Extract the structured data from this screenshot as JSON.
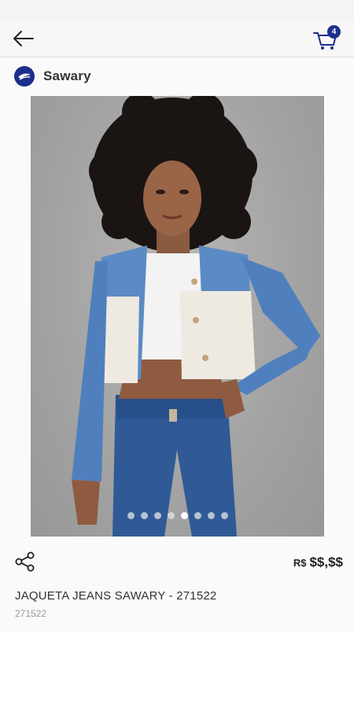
{
  "header": {
    "back_icon": "arrow-left-icon",
    "cart_icon": "shopping-cart-icon",
    "cart_count": "4"
  },
  "brand": {
    "name": "Sawary",
    "logo_icon": "sawary-logo-icon",
    "color": "#1c2f8a"
  },
  "gallery": {
    "image_alt": "Model wearing cropped denim jacket with sherpa panels and blue jeans",
    "slides_total": 8,
    "active_index": 4
  },
  "product": {
    "currency": "R$",
    "price": "$$,$$",
    "title": "JAQUETA JEANS SAWARY - 271522",
    "code": "271522",
    "share_icon": "share-icon"
  }
}
